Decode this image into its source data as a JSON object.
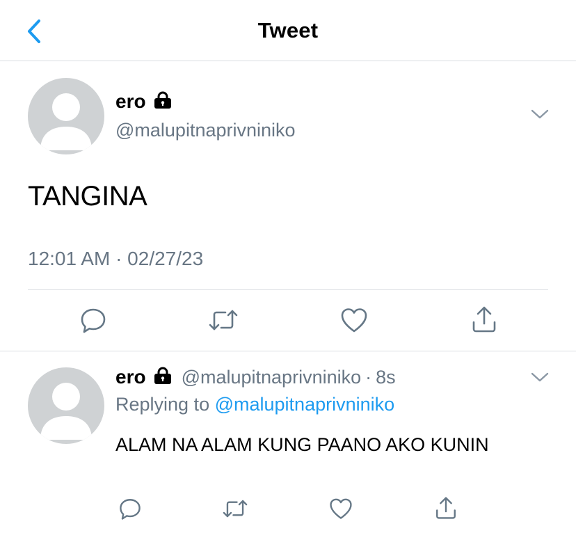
{
  "header": {
    "title": "Tweet"
  },
  "main_tweet": {
    "display_name": "ero",
    "handle": "@malupitnaprivniniko",
    "text": "TANGINA",
    "timestamp": "12:01 AM · 02/27/23",
    "locked": true
  },
  "reply_tweet": {
    "display_name": "ero",
    "handle": "@malupitnaprivniniko",
    "separator": "·",
    "age": "8s",
    "replying_prefix": "Replying to",
    "replying_to": "@malupitnaprivniniko",
    "text": "ALAM NA ALAM KUNG PAANO AKO KUNIN",
    "locked": true
  },
  "icons": {
    "back": "chevron-left-icon",
    "lock": "lock-icon",
    "more": "chevron-down-icon",
    "reply": "reply-icon",
    "retweet": "retweet-icon",
    "like": "heart-icon",
    "share": "share-icon"
  },
  "colors": {
    "accent": "#1d9bf0",
    "secondary_text": "#687684",
    "avatar_bg": "#cfd2d4",
    "divider": "#d9dde1"
  }
}
